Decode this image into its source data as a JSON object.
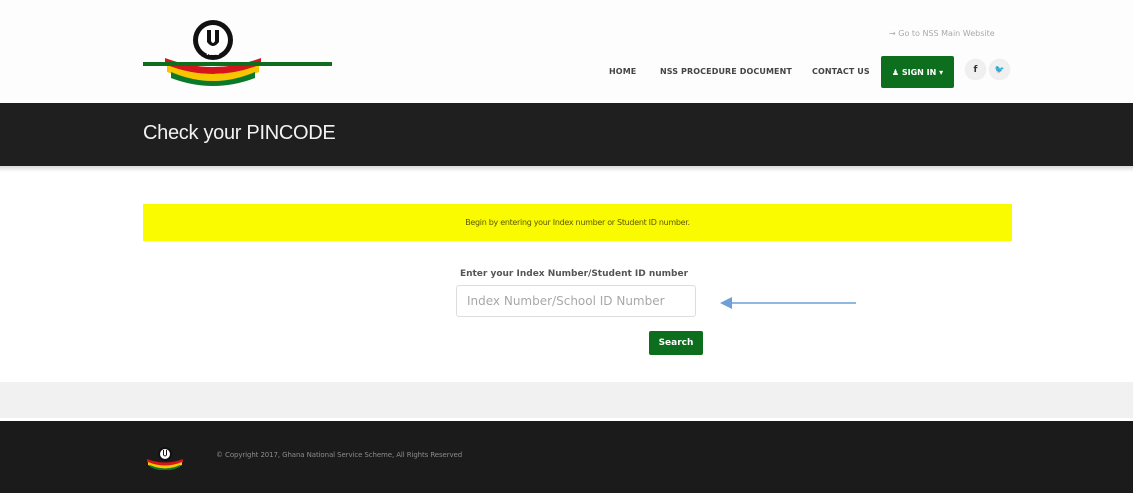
{
  "header": {
    "top_link": "→ Go to NSS Main Website",
    "nav": {
      "home": "HOME",
      "procedure": "NSS PROCEDURE DOCUMENT",
      "contact": "CONTACT US",
      "signin": "♟ SIGN IN ▾"
    },
    "social": {
      "facebook": "f",
      "twitter": "🐦"
    }
  },
  "banner": {
    "title": "Check your PINCODE"
  },
  "notice": {
    "text": "Begin by entering your Index number or Student ID number."
  },
  "form": {
    "label": "Enter your Index Number/Student ID number",
    "placeholder": "Index Number/School ID Number",
    "search_label": "Search"
  },
  "footer": {
    "copyright": "© Copyright 2017, Ghana National Service Scheme, All Rights Reserved"
  },
  "colors": {
    "brand_green": "#0d6e1e",
    "notice_yellow": "#fbfb00",
    "banner_dark": "#1f1f1f"
  },
  "icons": [
    "nss-logo",
    "user-icon",
    "caret-down-icon",
    "facebook-icon",
    "twitter-icon",
    "arrow-left-icon"
  ]
}
